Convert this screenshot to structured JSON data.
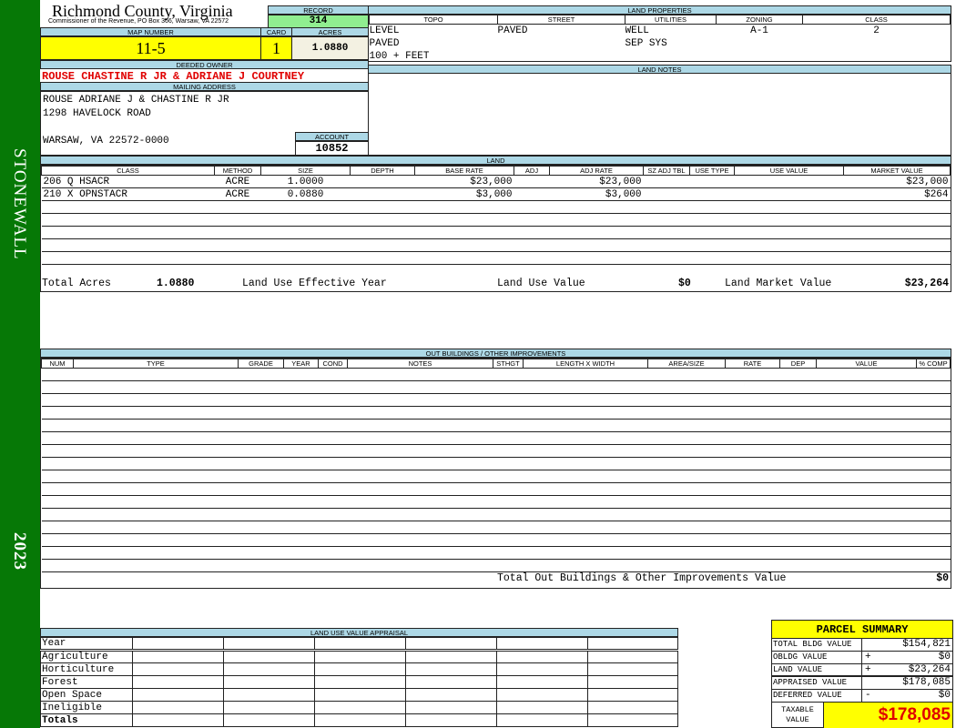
{
  "sidebar": {
    "district": "STONEWALL",
    "year": "2023"
  },
  "header": {
    "title": "Richmond County, Virginia",
    "subtitle": "Commissioner of the Revenue, PO Box 366, Warsaw, VA 22572"
  },
  "record": {
    "label": "RECORD",
    "value": "314"
  },
  "map": {
    "map_label": "MAP NUMBER",
    "map_value": "11-5",
    "card_label": "CARD",
    "card_value": "1",
    "acres_label": "ACRES",
    "acres_value": "1.0880"
  },
  "owner": {
    "label": "DEEDED OWNER",
    "value": "ROUSE CHASTINE R JR & ADRIANE J COURTNEY"
  },
  "mailing": {
    "label": "MAILING ADDRESS",
    "lines": [
      "ROUSE ADRIANE J & CHASTINE R JR",
      "1298 HAVELOCK ROAD",
      "",
      "WARSAW, VA 22572-0000"
    ]
  },
  "account": {
    "label": "ACCOUNT",
    "value": "10852"
  },
  "land_properties": {
    "label": "LAND PROPERTIES",
    "columns": [
      "TOPO",
      "STREET",
      "UTILITIES",
      "ZONING",
      "CLASS"
    ],
    "rows": [
      [
        "LEVEL",
        "PAVED",
        "WELL",
        "A-1",
        "2"
      ],
      [
        "PAVED",
        "",
        "SEP SYS",
        "",
        ""
      ],
      [
        "100 + FEET",
        "",
        "",
        "",
        ""
      ]
    ]
  },
  "land_notes": {
    "label": "LAND NOTES"
  },
  "land": {
    "label": "LAND",
    "columns": [
      "CLASS",
      "METHOD",
      "SIZE",
      "DEPTH",
      "BASE RATE",
      "ADJ",
      "ADJ RATE",
      "SZ ADJ TBL",
      "USE TYPE",
      "USE VALUE",
      "MARKET VALUE"
    ],
    "rows": [
      [
        "206 Q HSACR",
        "ACRE",
        "1.0000",
        "",
        "$23,000",
        "",
        "$23,000",
        "",
        "",
        "",
        "$23,000"
      ],
      [
        "210 X OPNSTACR",
        "ACRE",
        "0.0880",
        "",
        "$3,000",
        "",
        "$3,000",
        "",
        "",
        "",
        "$264"
      ]
    ],
    "totals": {
      "acres_label": "Total Acres",
      "acres": "1.0880",
      "effective_year_label": "Land Use Effective Year",
      "effective_year": "",
      "use_value_label": "Land Use Value",
      "use_value": "$0",
      "market_label": "Land Market Value",
      "market": "$23,264"
    }
  },
  "outbuildings": {
    "label": "OUT BUILDINGS / OTHER IMPROVEMENTS",
    "columns": [
      "NUM",
      "TYPE",
      "GRADE",
      "YEAR",
      "COND",
      "NOTES",
      "STHGT",
      "LENGTH X WIDTH",
      "AREA/SIZE",
      "RATE",
      "DEP",
      "VALUE",
      "% COMP"
    ],
    "total_label": "Total Out Buildings & Other Improvements Value",
    "total": "$0"
  },
  "land_use": {
    "label": "LAND USE VALUE APPRAISAL",
    "year_label": "Year",
    "rows": [
      "Agriculture",
      "Horticulture",
      "Forest",
      "Open Space",
      "Ineligible"
    ],
    "totals_label": "Totals"
  },
  "summary": {
    "title": "PARCEL SUMMARY",
    "rows": [
      {
        "label": "TOTAL BLDG VALUE",
        "sign": "",
        "value": "$154,821"
      },
      {
        "label": "OBLDG VALUE",
        "sign": "+",
        "value": "$0"
      },
      {
        "label": "LAND VALUE",
        "sign": "+",
        "value": "$23,264"
      },
      {
        "label": "APPRAISED VALUE",
        "sign": "",
        "value": "$178,085"
      },
      {
        "label": "DEFERRED VALUE",
        "sign": "-",
        "value": "$0"
      }
    ],
    "taxable_label": "TAXABLE VALUE",
    "taxable": "$178,085"
  },
  "colors": {
    "sidebar": "#067806",
    "label_bg": "#add8e6",
    "record_bg": "#90ee90",
    "highlight": "#ffff00",
    "owner_text": "#e00000"
  }
}
